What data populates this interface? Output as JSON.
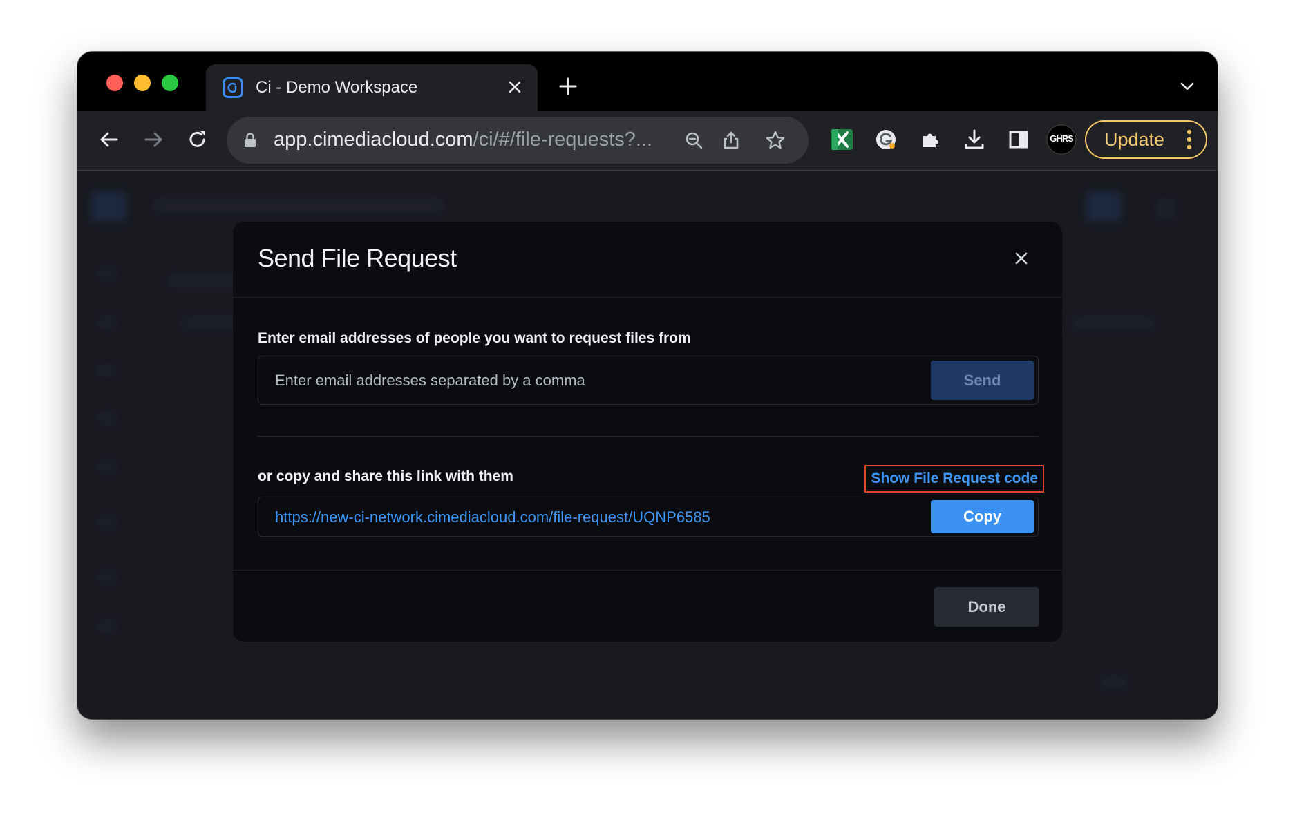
{
  "browser": {
    "tab": {
      "title": "Ci - Demo Workspace",
      "favicon": "ci-logo-icon"
    },
    "address_bar": {
      "domain": "app.cimediacloud.com",
      "path": "/ci/#/file-requests?..."
    },
    "update_label": "Update",
    "extension_badge_text": "GHRS"
  },
  "modal": {
    "title": "Send File Request",
    "email_section": {
      "label": "Enter email addresses of people you want to request files from",
      "input_placeholder": "Enter email addresses separated by a comma",
      "send_label": "Send"
    },
    "link_section": {
      "label": "or copy and share this link with them",
      "show_code_label": "Show File Request code",
      "link_value": "https://new-ci-network.cimediacloud.com/file-request/UQNP6585",
      "copy_label": "Copy"
    },
    "done_label": "Done"
  },
  "colors": {
    "accent": "#3a91f2",
    "highlight_border": "#e0462c",
    "update_yellow": "#f5c969"
  }
}
